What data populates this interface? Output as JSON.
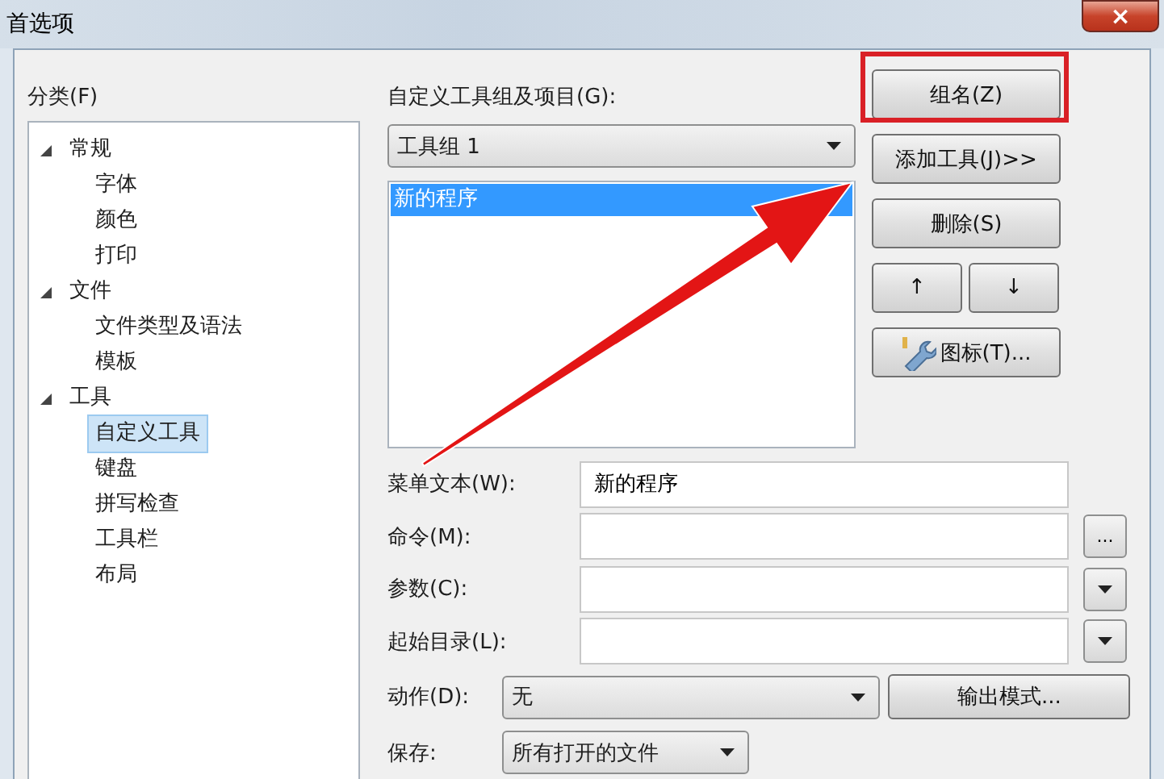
{
  "window": {
    "title": "首选项",
    "close": "×"
  },
  "category": {
    "label": "分类(F)",
    "tree": [
      {
        "label": "常规",
        "expanded": true,
        "selected": false,
        "children": [
          {
            "label": "字体",
            "selected": false
          },
          {
            "label": "颜色",
            "selected": false
          },
          {
            "label": "打印",
            "selected": false
          }
        ]
      },
      {
        "label": "文件",
        "expanded": true,
        "selected": false,
        "children": [
          {
            "label": "文件类型及语法",
            "selected": false
          },
          {
            "label": "模板",
            "selected": false
          }
        ]
      },
      {
        "label": "工具",
        "expanded": true,
        "selected": false,
        "children": [
          {
            "label": "自定义工具",
            "selected": true
          },
          {
            "label": "键盘",
            "selected": false
          },
          {
            "label": "拼写检查",
            "selected": false
          },
          {
            "label": "工具栏",
            "selected": false
          },
          {
            "label": "布局",
            "selected": false
          }
        ]
      }
    ]
  },
  "tools": {
    "label": "自定义工具组及项目(G):",
    "group": "工具组 1",
    "items": [
      {
        "label": "新的程序",
        "selected": true
      }
    ],
    "buttons": [
      {
        "label": "组名(Z)",
        "kind": "wide",
        "highlighted": true
      },
      {
        "label": "添加工具(J)>>",
        "kind": "wide",
        "highlighted": false
      },
      {
        "label": "删除(S)",
        "kind": "wide",
        "highlighted": false
      },
      {
        "label": "↑",
        "kind": "half",
        "highlighted": false
      },
      {
        "label": "↓",
        "kind": "half",
        "highlighted": false
      },
      {
        "label": "图标(T)...",
        "kind": "icon",
        "highlighted": false
      }
    ]
  },
  "fields": [
    {
      "label": "菜单文本(W):",
      "value": "新的程序",
      "kind": "plain"
    },
    {
      "label": "命令(M):",
      "kind": "button",
      "side_text": "..."
    },
    {
      "label": "参数(C):",
      "kind": "dropdown"
    },
    {
      "label": "起始目录(L):",
      "kind": "dropdown"
    }
  ],
  "action": {
    "label": "动作(D):",
    "value": "无",
    "button": "输出模式..."
  },
  "save": {
    "label": "保存:",
    "value": "所有打开的文件"
  }
}
